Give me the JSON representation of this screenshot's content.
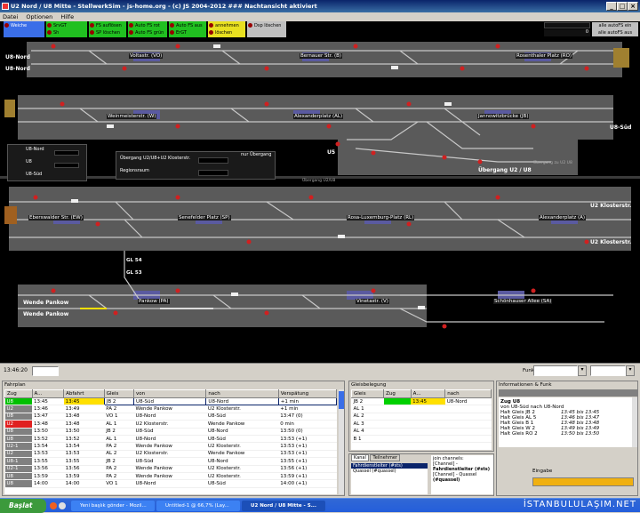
{
  "window": {
    "title": "U2 Nord / U8 Mitte - StellwerkSim - js-home.org - (c) JS 2004-2012  ### Nachtansicht aktiviert"
  },
  "menu": [
    "Datei",
    "Optionen",
    "Hilfe"
  ],
  "controls": {
    "weiche": "Weiche",
    "col1": [
      "SrvGT",
      "Sh"
    ],
    "col2": [
      "FS auflösen",
      "SP löschen"
    ],
    "col3": [
      "Auto FS rot",
      "Auto FS grün"
    ],
    "col4": [
      "Auto FS aus",
      "ErGT"
    ],
    "col5": [
      "annehmen",
      "löschen"
    ],
    "dsp": "Dsp löschen",
    "autofs_ein": "alle autoFS ein",
    "autofs_aus": "alle autoFS aus",
    "counter": "0"
  },
  "track": {
    "stations": [
      "Voltastr. (VO)",
      "Bernauer Str. (B)",
      "Rosenthaler Platz (RO)",
      "Weinmeisterstr. (W)",
      "Alexanderplatz (AL)",
      "Jannowitzbrücke (JB)",
      "Eberswalder Str. (EW)",
      "Senefelder Platz (SP)",
      "Rosa-Luxemburg-Platz (RL)",
      "Alexanderplatz (A)",
      "Pankow (PA)",
      "Vinetastr. (V)",
      "Schönhauser Allee (SA)"
    ],
    "labels": {
      "u8nord1": "U8-Nord",
      "u8nord2": "U8-Nord",
      "u8sued": "U8-Süd",
      "u5": "U5",
      "uebergang": "Übergang U2 / U8",
      "klost1": "U2 Klosterstr.",
      "klost2": "U2 Klosterstr.",
      "wende1": "Wende Pankow",
      "wende2": "Wende Pankow",
      "gl54": "GL 54",
      "gl53": "GL 53"
    },
    "legend": [
      "U8-Nord",
      "U8",
      "U8-Süd"
    ],
    "uebergang_box": {
      "line1": "Übergang U2/U8+U2 Klosterstr.",
      "line2": "Regionsraum",
      "nur": "nur Übergang"
    },
    "small1": "Übergang U2/U8",
    "small2": "Übergang zu U2 U8"
  },
  "status": {
    "time": "13:46:20",
    "funk_label": "Funk"
  },
  "fahrplan": {
    "title": "Fahrplan",
    "headers": [
      "Zug",
      "A...",
      "Abfahrt",
      "Gleis",
      "von",
      "nach",
      "Verspätung"
    ],
    "rows": [
      [
        "U8",
        "13:45",
        "13:45",
        "JB 2",
        "U8-Süd",
        "U8-Nord",
        "+1 min"
      ],
      [
        "U2",
        "13:46",
        "13:49",
        "PA 2",
        "Wende Pankow",
        "U2 Klosterstr.",
        "+1 min"
      ],
      [
        "U8",
        "13:47",
        "13:48",
        "VO 1",
        "U8-Nord",
        "U8-Süd",
        "13:47 (0)"
      ],
      [
        "U2",
        "13:48",
        "13:48",
        "AL 1",
        "U2 Klosterstr.",
        "Wende Pankow",
        "0 min"
      ],
      [
        "U8",
        "13:50",
        "13:50",
        "JB 2",
        "U8-Süd",
        "U8-Nord",
        "13:50 (0)"
      ],
      [
        "U8",
        "13:52",
        "13:52",
        "AL 1",
        "U8-Nord",
        "U8-Süd",
        "13:53 (+1)"
      ],
      [
        "U2-1",
        "13:54",
        "13:54",
        "PA 2",
        "Wende Pankow",
        "U2 Klosterstr.",
        "13:53 (+1)"
      ],
      [
        "U2",
        "13:53",
        "13:53",
        "AL 2",
        "U2 Klosterstr.",
        "Wende Pankow",
        "13:53 (+1)"
      ],
      [
        "U8-1",
        "13:55",
        "13:55",
        "JB 2",
        "U8-Süd",
        "U8-Nord",
        "13:55 (+1)"
      ],
      [
        "U2-1",
        "13:56",
        "13:56",
        "PA 2",
        "Wende Pankow",
        "U2 Klosterstr.",
        "13:56 (+1)"
      ],
      [
        "U8",
        "13:59",
        "13:59",
        "PA 2",
        "Wende Pankow",
        "U2 Klosterstr.",
        "13:59 (+1)"
      ],
      [
        "U8",
        "14:00",
        "14:00",
        "VO 1",
        "U8-Nord",
        "U8-Süd",
        "14:00 (+1)"
      ]
    ],
    "row_colors": [
      "#00c000",
      "#808080",
      "#808080",
      "#e02020",
      "#808080",
      "#808080",
      "#808080",
      "#808080",
      "#808080",
      "#808080",
      "#808080",
      "#808080"
    ]
  },
  "gleisbelegung": {
    "title": "Gleisbelegung",
    "headers": [
      "Gleis",
      "Zug",
      "A...",
      "nach"
    ],
    "rows": [
      [
        "JB 2",
        "",
        "13:45",
        "U8-Nord"
      ],
      [
        "AL 1",
        "",
        "",
        ""
      ],
      [
        "AL 2",
        "",
        "",
        ""
      ],
      [
        "AL 3",
        "",
        "",
        ""
      ],
      [
        "AL 4",
        "",
        "",
        ""
      ],
      [
        "B 1",
        "",
        "",
        ""
      ]
    ]
  },
  "chat": {
    "tabs": [
      "Kanal",
      "Teilnehmer"
    ],
    "channels": [
      "Fahrdienstleiter (#sts)",
      "Quassel (#quassel)"
    ],
    "msgs": [
      "join channels:",
      "[Channel] -",
      "Fahrdienstleiter (#sts)",
      "[Channel] - Quassel",
      "(#quassel)"
    ],
    "eingabe": "Eingabe"
  },
  "info": {
    "title": "Informationen & Funk",
    "heading": "Zug U8",
    "sub": "von U8-Süd nach U8-Nord",
    "rows": [
      [
        "Halt Gleis JB 2",
        "13:45 bis 13:45"
      ],
      [
        "Halt Gleis AL 5",
        "13:46 bis 13:47"
      ],
      [
        "Halt Gleis B 1",
        "13:48 bis 13:48"
      ],
      [
        "Halt Gleis W 2",
        "13:49 bis 13:49"
      ],
      [
        "Halt Gleis RO 2",
        "13:50 bis 13:50"
      ]
    ]
  },
  "taskbar": {
    "start": "Başlat",
    "items": [
      "Yeni başlık gönder - Mozil...",
      "Untitled-1 @ 66,7% (Lay...",
      "U2 Nord / U8 Mitte - S..."
    ],
    "watermark": "İSTANBULULAŞIM.NET"
  }
}
